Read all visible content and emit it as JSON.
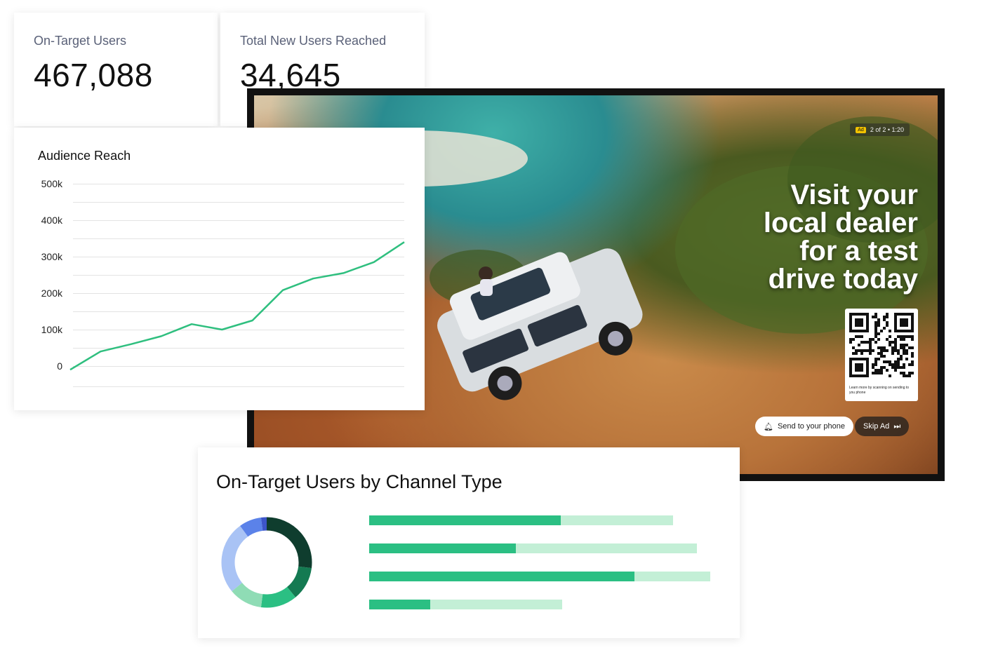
{
  "kpis": [
    {
      "label": "On-Target Users",
      "value": "467,088"
    },
    {
      "label": "Total New Users Reached",
      "value": "34,645"
    }
  ],
  "ad": {
    "badge_tag": "Ad",
    "badge_text": "2 of 2  •  1:20",
    "headline": [
      "Visit your",
      "local dealer",
      "for a test",
      "drive today"
    ],
    "qr_caption": "Learn more by scanning on sending to you phone",
    "send_button": "Send to your phone",
    "skip_button": "Skip Ad",
    "icons": {
      "send": "bell-icon",
      "skip": "skip-next-icon"
    }
  },
  "reach": {
    "title": "Audience Reach",
    "chart_data": {
      "type": "line",
      "title": "Audience Reach",
      "yticks": [
        "500k",
        "400k",
        "300k",
        "200k",
        "100k",
        "0"
      ],
      "ylim": [
        0,
        500000
      ],
      "grid": true,
      "series": [
        {
          "color": "#2fbf7f",
          "values": [
            -10000,
            40000,
            60000,
            82000,
            115000,
            100000,
            125000,
            208000,
            240000,
            255000,
            285000,
            340000
          ]
        }
      ]
    }
  },
  "channel": {
    "title": "On-Target Users by Channel Type",
    "chart_data": [
      {
        "type": "pie",
        "slices": [
          {
            "value": 27,
            "color": "#0f3d2e"
          },
          {
            "value": 12,
            "color": "#147a52"
          },
          {
            "value": 13,
            "color": "#2bbf83"
          },
          {
            "value": 12,
            "color": "#8fdcb5"
          },
          {
            "value": 26,
            "color": "#a9c3f5"
          },
          {
            "value": 8,
            "color": "#5b82e9"
          },
          {
            "value": 2,
            "color": "#3d55c9"
          }
        ]
      },
      {
        "type": "bar",
        "orientation": "horizontal",
        "colors": {
          "value": "#2bbf83",
          "total": "#c3efd6"
        },
        "bars": [
          {
            "value": 273,
            "total": 433
          },
          {
            "value": 209,
            "total": 467
          },
          {
            "value": 378,
            "total": 486
          },
          {
            "value": 87,
            "total": 275
          }
        ]
      }
    ]
  }
}
